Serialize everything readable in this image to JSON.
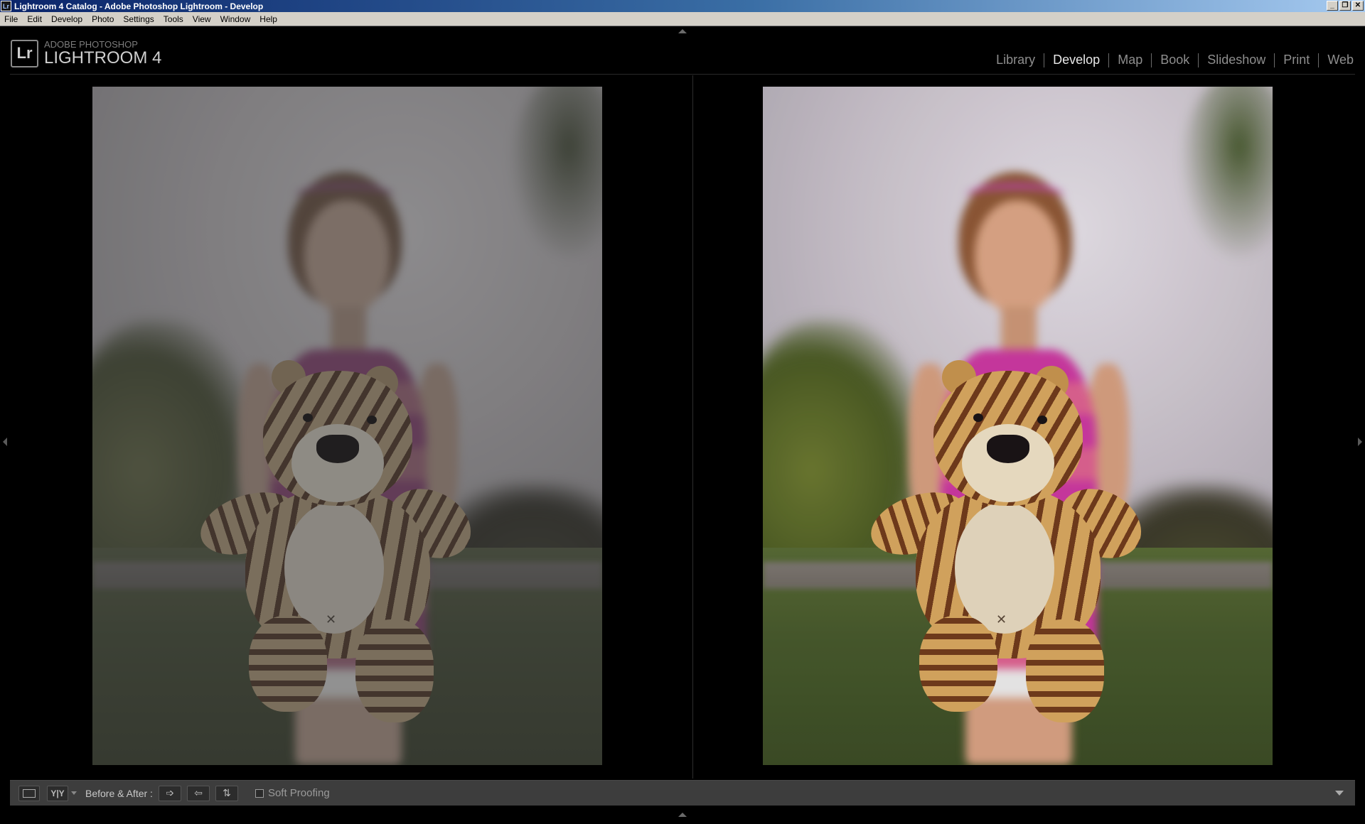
{
  "window": {
    "title": "Lightroom 4 Catalog - Adobe Photoshop Lightroom - Develop",
    "app_icon_text": "Lr",
    "controls": {
      "minimize": "_",
      "restore": "❐",
      "close": "✕"
    }
  },
  "menu": {
    "items": [
      "File",
      "Edit",
      "Develop",
      "Photo",
      "Settings",
      "Tools",
      "View",
      "Window",
      "Help"
    ]
  },
  "identity_plate": {
    "logo_text": "Lr",
    "line1": "ADOBE PHOTOSHOP",
    "line2": "LIGHTROOM 4"
  },
  "modules": {
    "items": [
      "Library",
      "Develop",
      "Map",
      "Book",
      "Slideshow",
      "Print",
      "Web"
    ],
    "active": "Develop"
  },
  "photo": {
    "tag_mark": "✕"
  },
  "toolbar": {
    "loupe_icon": "loupe-view-icon",
    "compare_mode_label": "Y|Y",
    "before_after_label": "Before & After :",
    "copy_before_to_after": "➩",
    "copy_after_to_before": "⇦",
    "swap_icon": "⇅",
    "soft_proofing_label": "Soft Proofing",
    "soft_proofing_checked": false
  },
  "colors": {
    "panel_bg": "#3d3d3d",
    "active_module": "#e8e8e8",
    "inactive_module": "#8e8e8e"
  }
}
